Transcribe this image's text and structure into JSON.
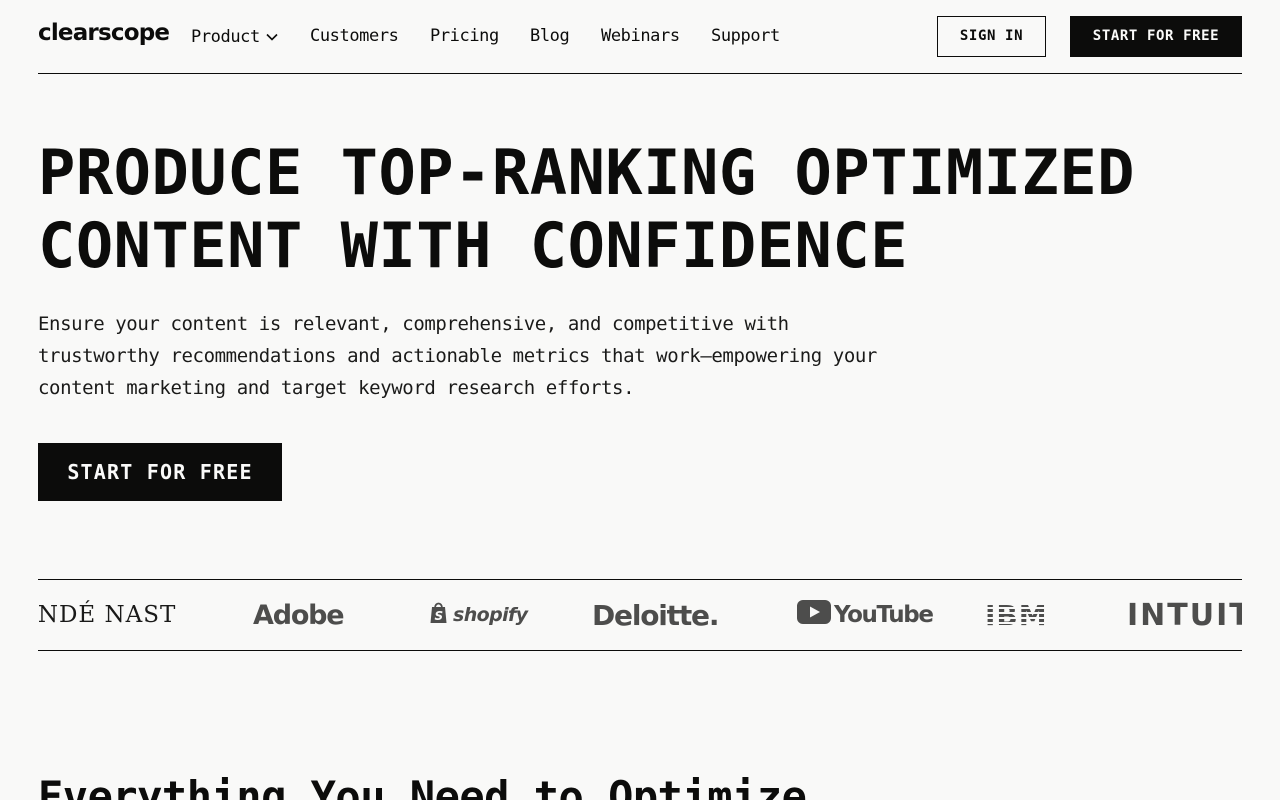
{
  "brand": {
    "name": "clearscope"
  },
  "nav": {
    "items": [
      {
        "label": "Product",
        "has_dropdown": true
      },
      {
        "label": "Customers"
      },
      {
        "label": "Pricing"
      },
      {
        "label": "Blog"
      },
      {
        "label": "Webinars"
      },
      {
        "label": "Support"
      }
    ],
    "sign_in_label": "SIGN IN",
    "start_label": "START FOR FREE"
  },
  "hero": {
    "title_line1": "PRODUCE TOP-RANKING OPTIMIZED",
    "title_line2": "CONTENT WITH CONFIDENCE",
    "subtitle": "Ensure your content is relevant, comprehensive, and competitive with trustworthy recommendations and actionable metrics that work—empowering your content marketing and target keyword research efforts.",
    "cta_label": "START FOR FREE"
  },
  "logos": [
    {
      "name": "ONDÉ NAST"
    },
    {
      "name": "Adobe"
    },
    {
      "name": "shopify",
      "icon": "shopping-bag-icon"
    },
    {
      "name": "Deloitte."
    },
    {
      "name": "YouTube",
      "icon": "play-button-icon"
    },
    {
      "name": "IBM"
    },
    {
      "name": "INTUIT"
    }
  ],
  "section": {
    "title": "Everything You Need to Optimize"
  },
  "colors": {
    "text": "#0c0c0b",
    "background": "#f9f9f8",
    "logo_gray": "#4d4d4c"
  }
}
